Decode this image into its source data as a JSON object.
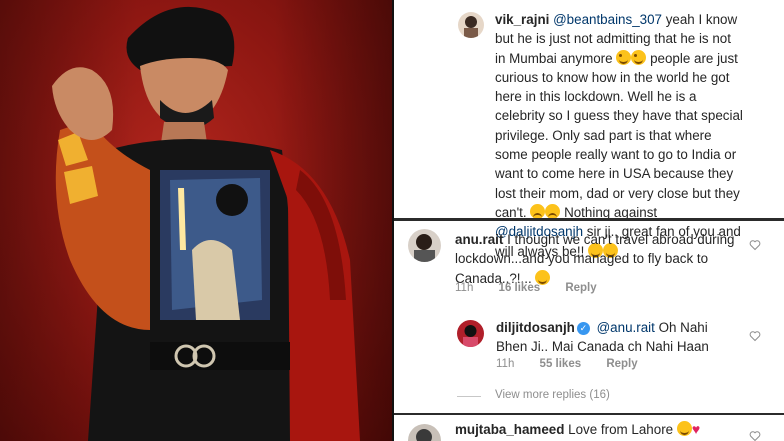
{
  "comments": [
    {
      "username": "vik_rajni",
      "mention": "@beantbains_307",
      "text_1": "yeah I know but he is just not admitting that he is not in Mumbai anymore",
      "text_2": "people are just curious to know how in the world he got here in this lockdown. Well he is a celebrity so I guess they have that special privilege. Only sad part is that where some people really want to go to India or want to come here in USA because they lost their mom, dad or very close but they can't.",
      "text_3": "Nothing against",
      "mention_2": "@daljitdosanjh",
      "text_4": "sir ji.. great fan of you and will always be!!"
    },
    {
      "username": "anu.rait",
      "text": "I thought we can't travel abroad during lockdown...and you managed to fly back to Canada..?!...",
      "time": "11h",
      "likes": "16 likes",
      "reply": "Reply"
    },
    {
      "username": "diljitdosanjh",
      "verified_icon": "verified-badge-icon",
      "mention": "@anu.rait",
      "text": "Oh Nahi Bhen Ji.. Mai Canada ch Nahi Haan",
      "time": "11h",
      "likes": "55 likes",
      "reply": "Reply"
    },
    {
      "username": "mujtaba_hameed",
      "text": "Love from Lahore"
    }
  ],
  "view_more": "View more replies (16)",
  "colors": {
    "mention": "#00376b",
    "meta": "#8e8e8e",
    "verified": "#3897f0",
    "photo_bg": "#8e1712"
  }
}
